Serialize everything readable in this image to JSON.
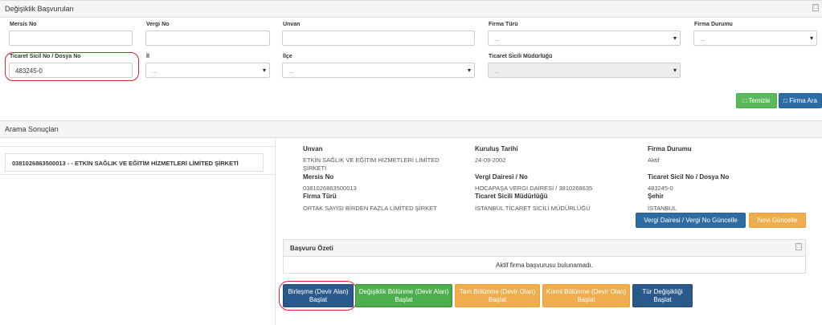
{
  "search_panel": {
    "title": "Değişiklik Başvuruları",
    "labels": {
      "mersis": "Mersis No",
      "vergi": "Vergi No",
      "unvan": "Unvan",
      "firma_turu": "Firma Türü",
      "firma_durumu": "Firma Durumu",
      "ticaret_sicil": "Ticaret Sicil No / Dosya No",
      "il": "İl",
      "ilce": "İlçe",
      "mudurlugu": "Ticaret Sicili Müdürlüğü"
    },
    "values": {
      "mersis": "",
      "vergi": "",
      "unvan": "",
      "ticaret_sicil": "483245-0"
    },
    "select_placeholder": "...",
    "buttons": {
      "temizle": "Temizle",
      "firma_ara": "Firma Ara"
    }
  },
  "results_panel": {
    "title": "Arama Sonuçları",
    "items": [
      "0381026863500013 - - ETKİN SAĞLIK VE EĞİTİM HİZMETLERİ LİMİTED ŞİRKETİ"
    ]
  },
  "details": {
    "unvan_label": "Unvan",
    "unvan_value_line1": "ETKİN SAĞLIK VE EĞİTİM HİZMETLERİ LİMİTED",
    "unvan_value_line2": "ŞİRKETİ",
    "kurulus_label": "Kuruluş Tarihi",
    "kurulus_value": "24-09-2002",
    "durum_label": "Firma Durumu",
    "durum_value": "Aktif",
    "mersis_label": "Mersis No",
    "mersis_value": "0381026863500013",
    "vergi_label": "Vergi Dairesi / No",
    "vergi_value": "HOCAPAŞA VERGİ DAİRESİ / 3810268635",
    "sicil_label": "Ticaret Sicil No / Dosya No",
    "sicil_value": "483245-0",
    "turu_label": "Firma Türü",
    "turu_value": "ORTAK SAYISI BİRDEN FAZLA LİMİTED ŞİRKET",
    "mudurluk_label": "Ticaret Sicili Müdürlüğü",
    "mudurluk_value": "İSTANBUL TİCARET SİCİLİ MÜDÜRLÜĞÜ",
    "sehir_label": "Şehir",
    "sehir_value": "İSTANBUL",
    "buttons": {
      "vergi_guncelle": "Vergi Dairesi / Vergi No Güncelle",
      "nevi_guncelle": "Nevi Güncelle"
    }
  },
  "summary": {
    "title": "Başvuru Özeti",
    "message": "Aktif firma başvurusu bulunamadı."
  },
  "actions": [
    {
      "line1": "Birleşme (Devir Alan)",
      "line2": "Başlat"
    },
    {
      "line1": "Değişiklik Bölünme (Devir Alan)",
      "line2": "Başlat"
    },
    {
      "line1": "Tam Bölünme (Devir Olan)",
      "line2": "Başlat"
    },
    {
      "line1": "Kısmi Bölünme (Devir Olan)",
      "line2": "Başlat"
    },
    {
      "line1": "Tür Değişikliği",
      "line2": "Başlat"
    }
  ],
  "icons": {
    "collapse": "□",
    "caret": "▾"
  },
  "colors": {
    "success": "#5cb85c",
    "primary": "#2e6da4",
    "warning": "#f0ad4e",
    "highlight": "#d9232d"
  }
}
